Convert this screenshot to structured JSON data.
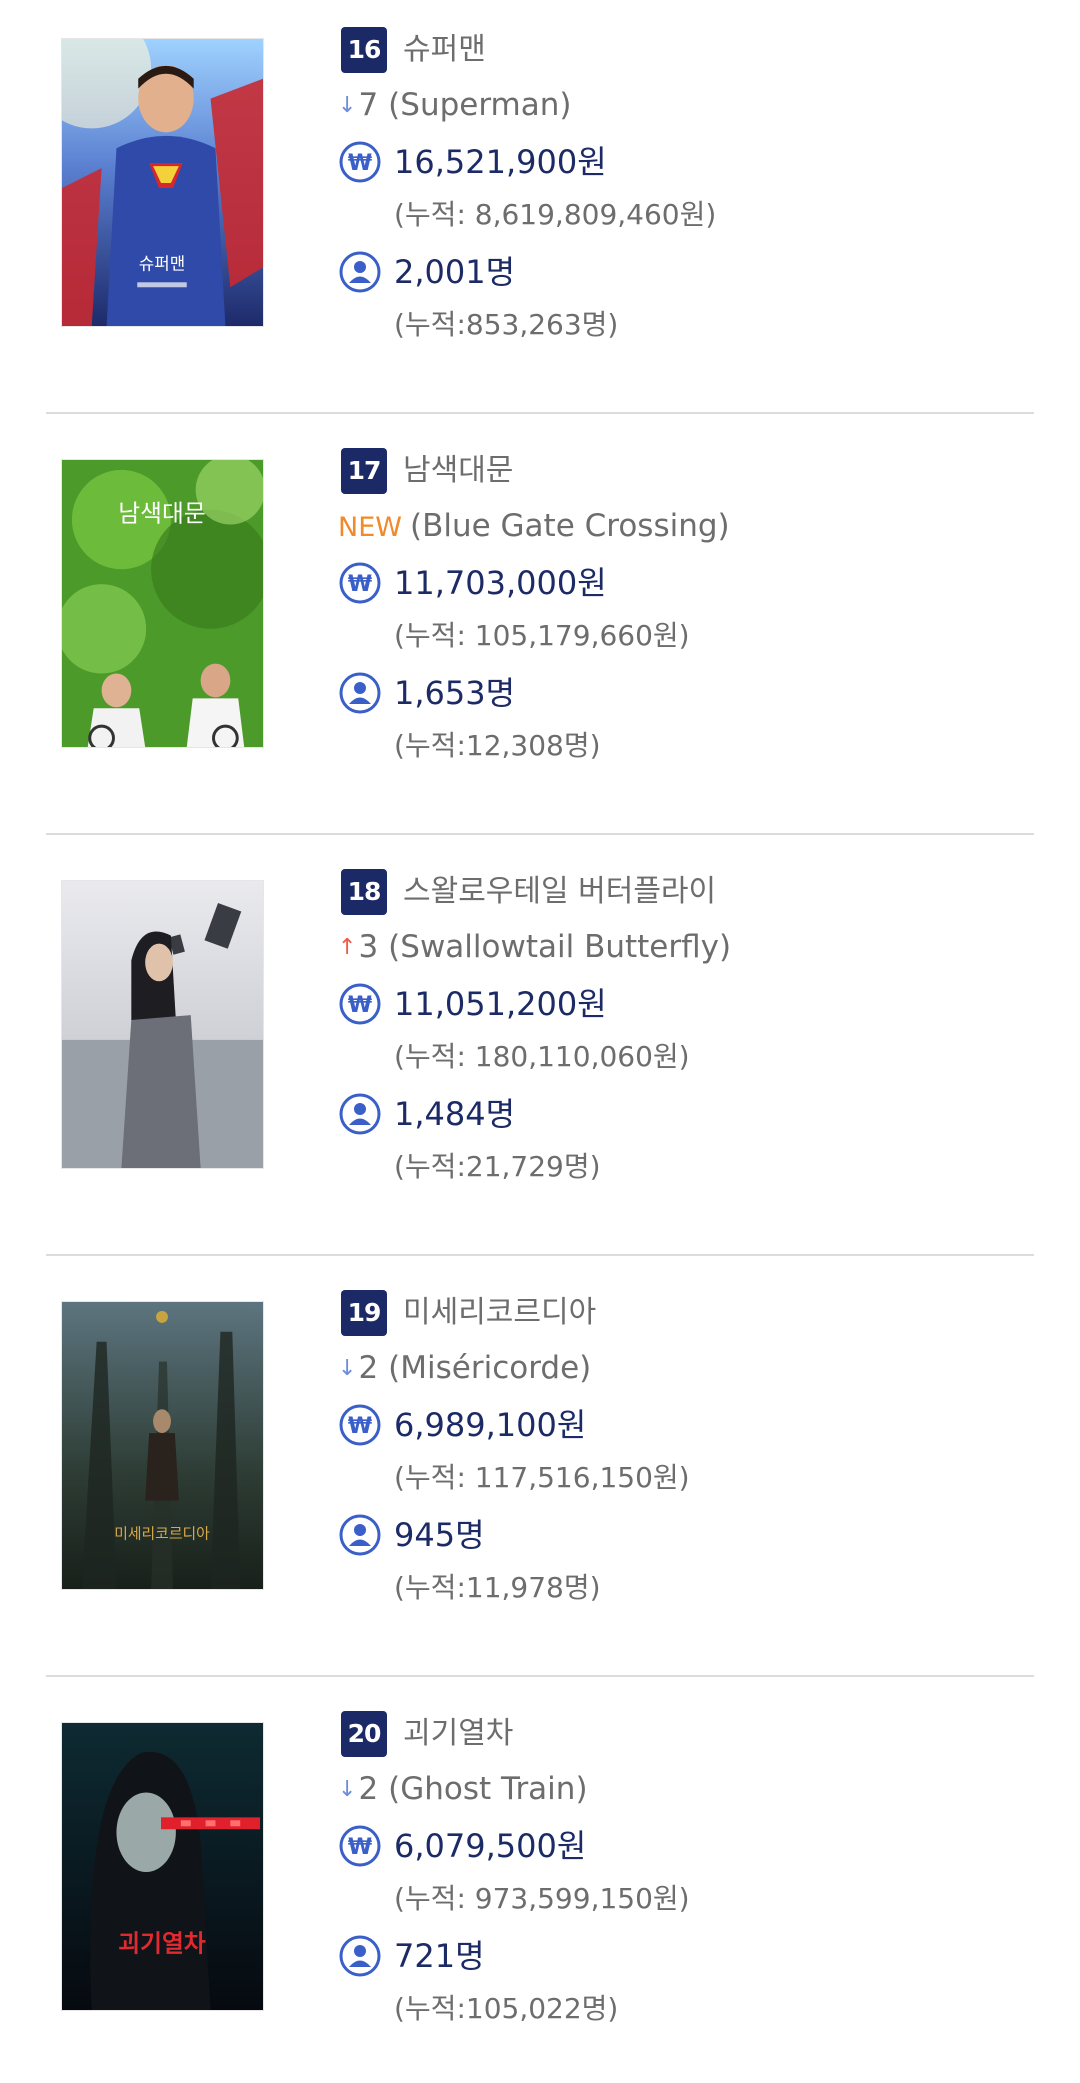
{
  "movies": [
    {
      "rank": "16",
      "title_ko": "슈퍼맨",
      "change_dir": "down",
      "change_arrow": "↓",
      "change_value": "7",
      "title_en": "(Superman)",
      "revenue": "16,521,900원",
      "revenue_cum": "(누적: 8,619,809,460원)",
      "audience": "2,001명",
      "audience_cum": "(누적:853,263명)",
      "poster_text": "슈퍼맨"
    },
    {
      "rank": "17",
      "title_ko": "남색대문",
      "change_dir": "new",
      "change_label": "NEW",
      "title_en": "(Blue Gate Crossing)",
      "revenue": "11,703,000원",
      "revenue_cum": "(누적: 105,179,660원)",
      "audience": "1,653명",
      "audience_cum": "(누적:12,308명)",
      "poster_text": "남색대문"
    },
    {
      "rank": "18",
      "title_ko": "스왈로우테일 버터플라이",
      "change_dir": "up",
      "change_arrow": "↑",
      "change_value": "3",
      "title_en": "(Swallowtail Butterfly)",
      "revenue": "11,051,200원",
      "revenue_cum": "(누적: 180,110,060원)",
      "audience": "1,484명",
      "audience_cum": "(누적:21,729명)",
      "poster_text": ""
    },
    {
      "rank": "19",
      "title_ko": "미세리코르디아",
      "change_dir": "down",
      "change_arrow": "↓",
      "change_value": "2",
      "title_en": "(Miséricorde)",
      "revenue": "6,989,100원",
      "revenue_cum": "(누적: 117,516,150원)",
      "audience": "945명",
      "audience_cum": "(누적:11,978명)",
      "poster_text": "미세리코르디아"
    },
    {
      "rank": "20",
      "title_ko": "괴기열차",
      "change_dir": "down",
      "change_arrow": "↓",
      "change_value": "2",
      "title_en": "(Ghost Train)",
      "revenue": "6,079,500원",
      "revenue_cum": "(누적: 973,599,150원)",
      "audience": "721명",
      "audience_cum": "(누적:105,022명)",
      "poster_text": "괴기열차"
    }
  ],
  "icons": {
    "revenue": "won-coin-icon",
    "audience": "user-avatar-icon"
  },
  "colors": {
    "badge": "#1b2a66",
    "value_text": "#1c2b66",
    "icon_blue": "#3a5fc8",
    "arrow_down": "#6b8ddc",
    "arrow_up": "#ef5a4a",
    "new_label": "#f08a2a"
  }
}
